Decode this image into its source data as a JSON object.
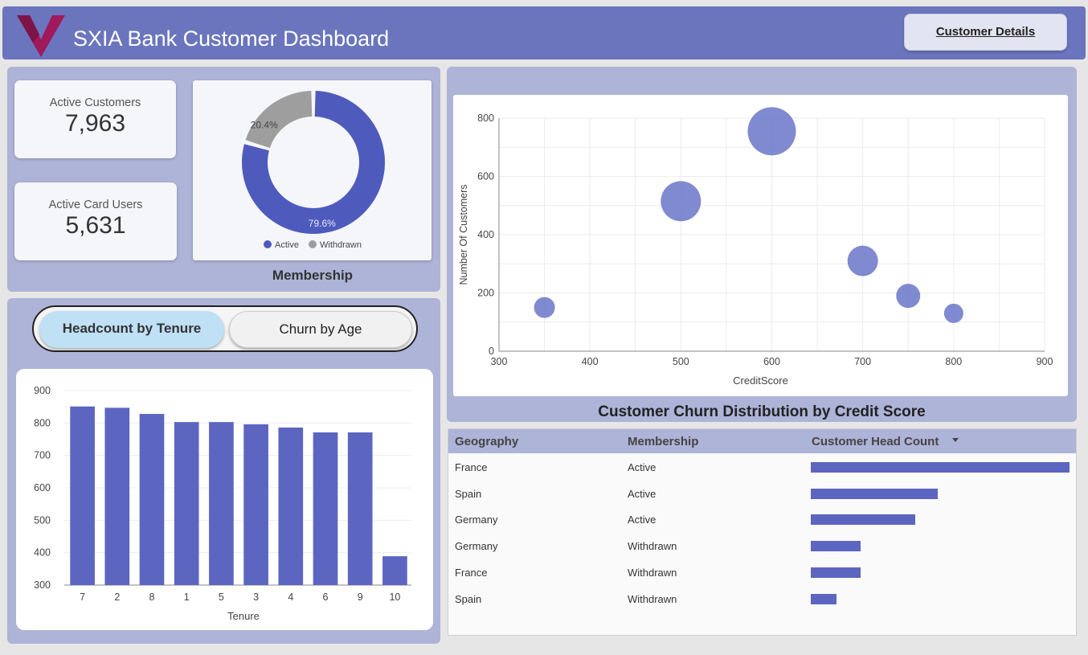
{
  "header": {
    "title": "SXIA Bank Customer Dashboard",
    "details_button": "Customer Details",
    "colors": {
      "bar": "#6a75bd",
      "logo": "#a0195a"
    }
  },
  "kpis": [
    {
      "label": "Active Customers",
      "value": "7,963"
    },
    {
      "label": "Active Card Users",
      "value": "5,631"
    }
  ],
  "membership": {
    "title": "Membership",
    "chart_data": {
      "type": "pie",
      "categories": [
        "Active",
        "Withdrawn"
      ],
      "values": [
        79.6,
        20.4
      ],
      "labels": [
        "79.6%",
        "20.4%"
      ],
      "colors": [
        "#4e5bbd",
        "#9e9e9e"
      ],
      "legend": "bottom"
    }
  },
  "toggle": {
    "active_label": "Headcount by Tenure",
    "inactive_label": "Churn by Age"
  },
  "tenure_chart": {
    "chart_data": {
      "type": "bar",
      "categories": [
        "7",
        "2",
        "8",
        "1",
        "5",
        "3",
        "4",
        "6",
        "9",
        "10"
      ],
      "values": [
        851,
        847,
        828,
        803,
        803,
        796,
        786,
        771,
        771,
        389
      ],
      "xlabel": "Tenure",
      "ylabel": "",
      "ylim": [
        300,
        900
      ],
      "yticks": [
        300,
        400,
        500,
        600,
        700,
        800,
        900
      ],
      "color": "#5c66c1",
      "grid": true
    }
  },
  "credit_chart": {
    "title": "Customer Churn Distribution by Credit Score",
    "chart_data": {
      "type": "scatter",
      "x": [
        350,
        500,
        600,
        700,
        750,
        800
      ],
      "y": [
        150,
        515,
        755,
        310,
        190,
        130
      ],
      "size": [
        13,
        25,
        30,
        19,
        15,
        12
      ],
      "xlabel": "CreditScore",
      "ylabel": "Number Of Customers",
      "xlim": [
        300,
        900
      ],
      "ylim": [
        0,
        800
      ],
      "xticks": [
        300,
        400,
        500,
        600,
        700,
        800,
        900
      ],
      "yticks": [
        0,
        200,
        400,
        600,
        800
      ],
      "color": "#6a75c8",
      "grid": true
    }
  },
  "table": {
    "headers": [
      "Geography",
      "Membership",
      "Customer Head Count"
    ],
    "sort_icon": "caret-down-icon",
    "rows": [
      {
        "geography": "France",
        "membership": "Active",
        "fraction": 1.0
      },
      {
        "geography": "Spain",
        "membership": "Active",
        "fraction": 0.49
      },
      {
        "geography": "Germany",
        "membership": "Active",
        "fraction": 0.404
      },
      {
        "geography": "Germany",
        "membership": "Withdrawn",
        "fraction": 0.193
      },
      {
        "geography": "France",
        "membership": "Withdrawn",
        "fraction": 0.193
      },
      {
        "geography": "Spain",
        "membership": "Withdrawn",
        "fraction": 0.1
      }
    ]
  }
}
